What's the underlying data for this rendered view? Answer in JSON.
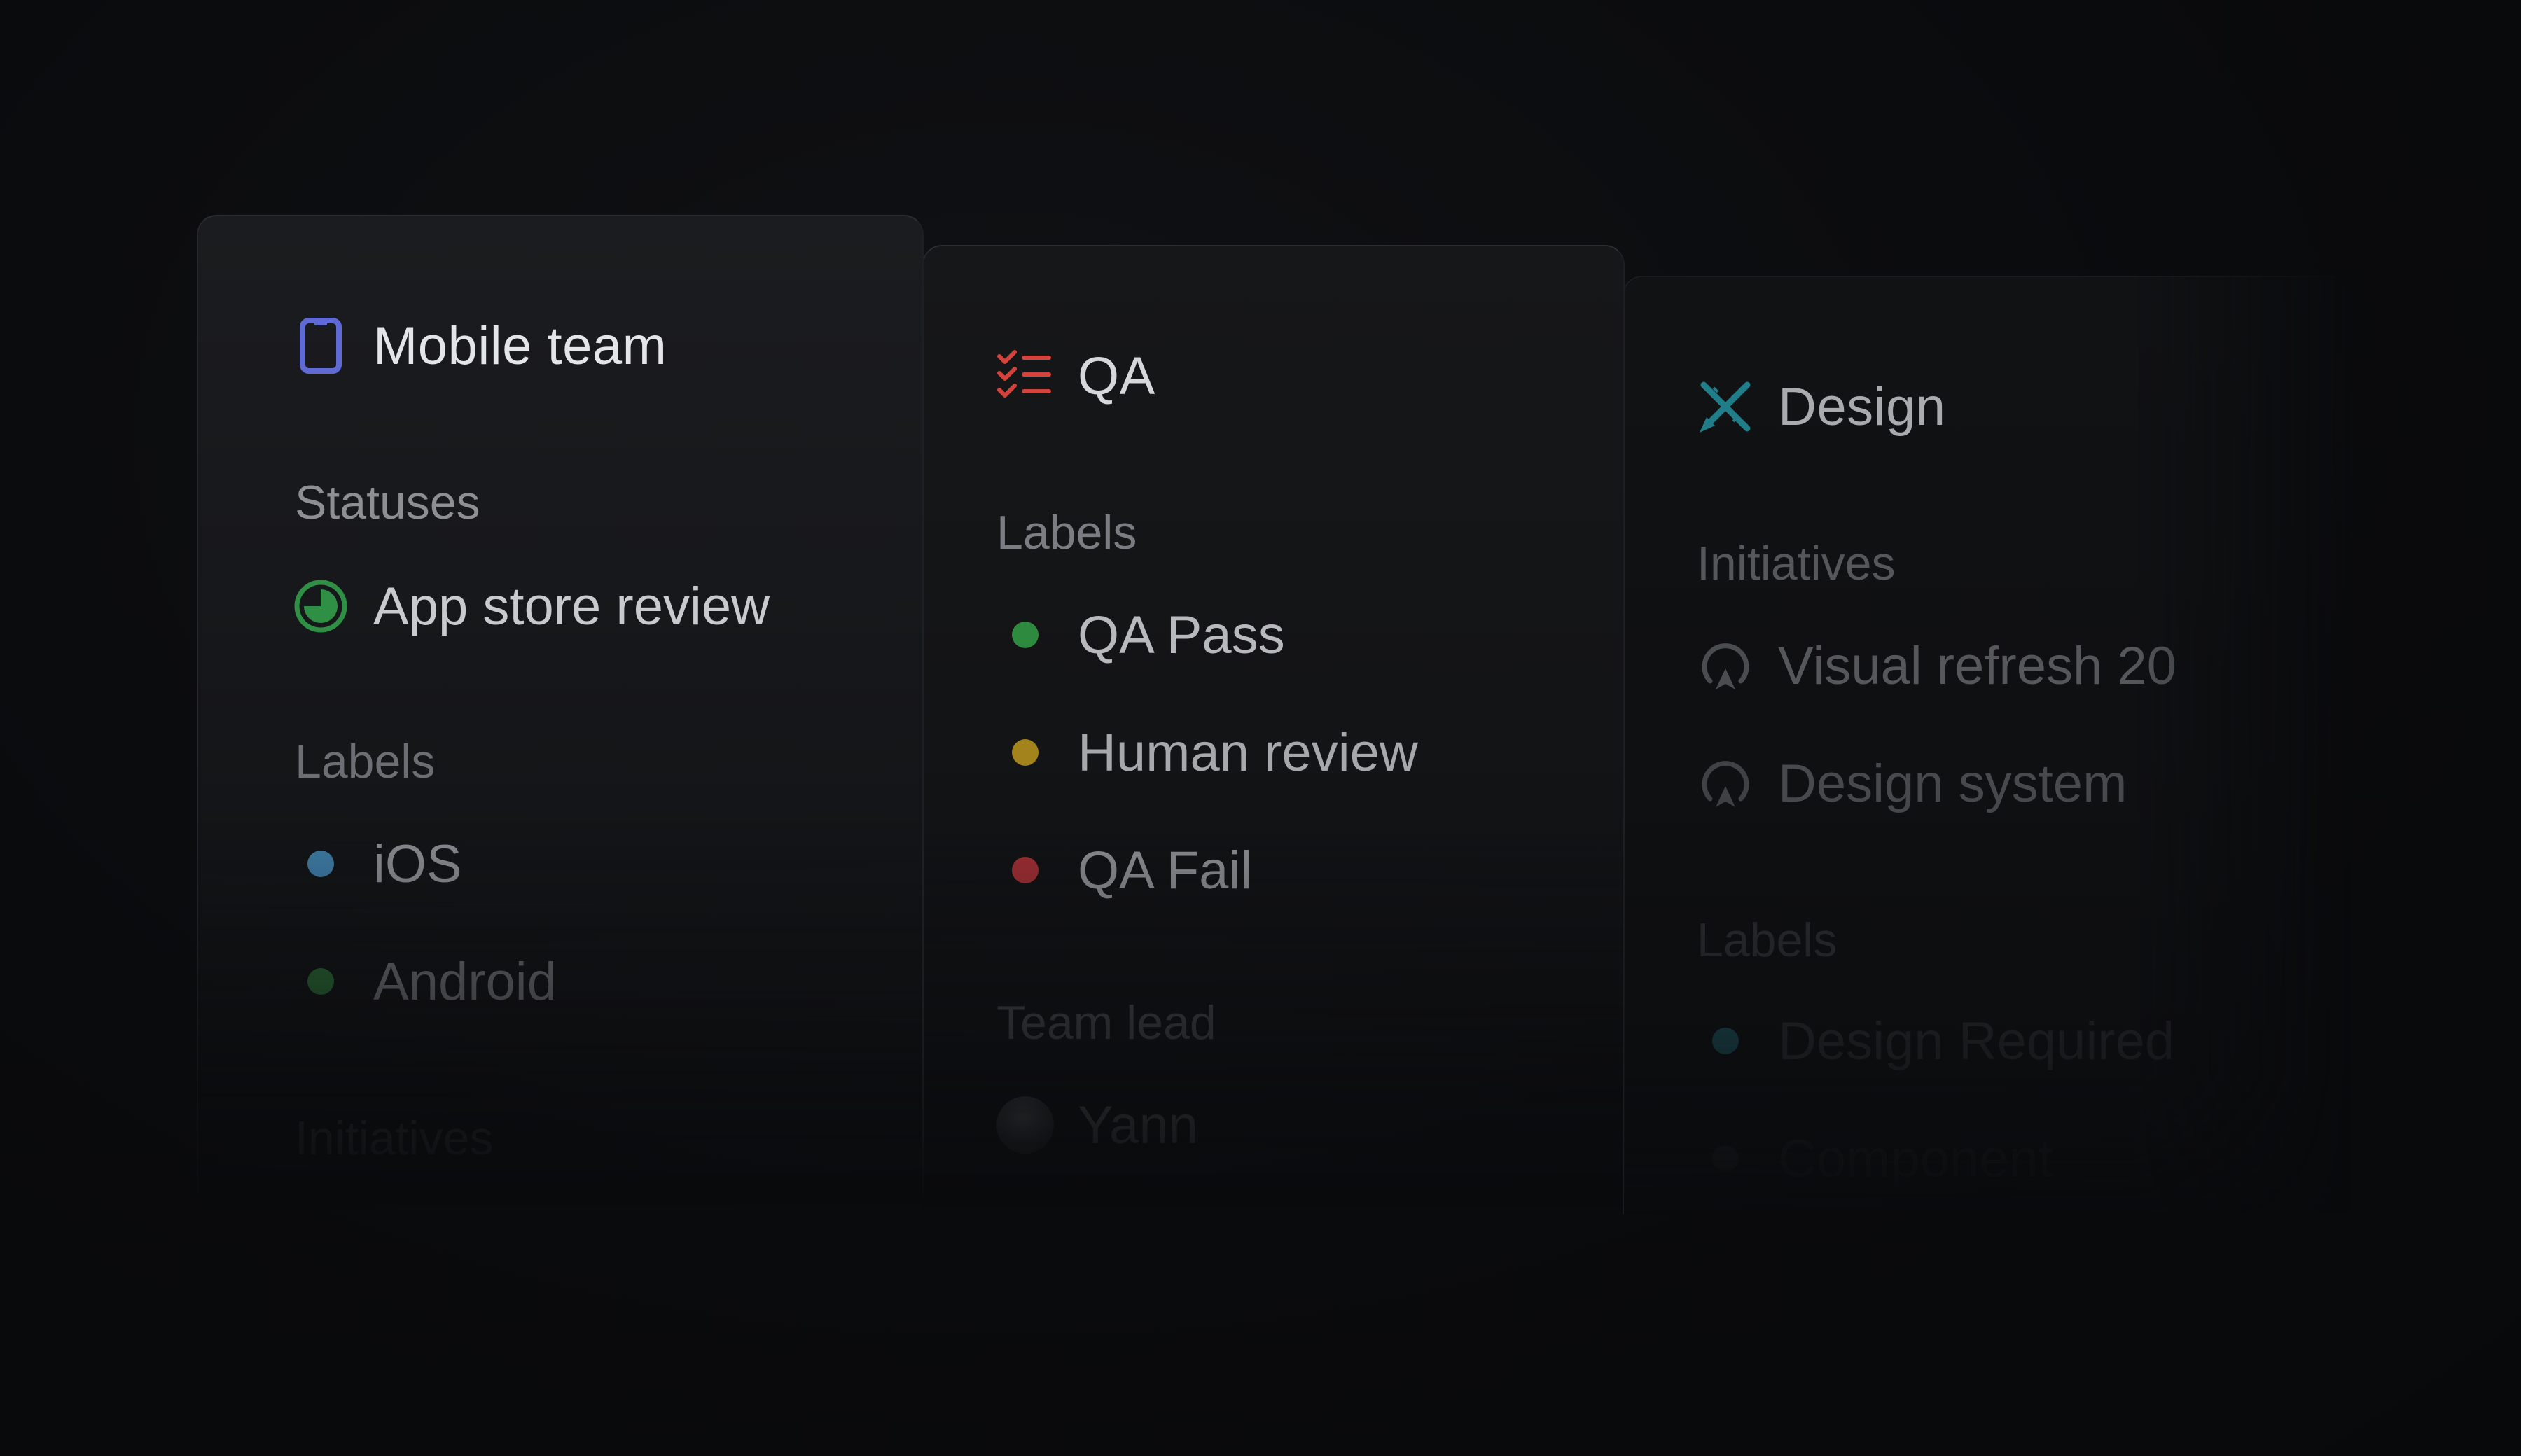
{
  "teams": {
    "mobile": {
      "name": "Mobile team",
      "icon": "phone-icon",
      "icon_color": "#5f6ad6",
      "statuses_title": "Statuses",
      "statuses": [
        {
          "label": "App store review",
          "icon": "status-progress-icon",
          "color": "#2f8f45"
        }
      ],
      "labels_title": "Labels",
      "labels": [
        {
          "label": "iOS",
          "color": "#3f7ea8"
        },
        {
          "label": "Android",
          "color": "#2a6a34"
        }
      ],
      "initiatives_title": "Initiatives"
    },
    "qa": {
      "name": "QA",
      "icon": "checklist-icon",
      "icon_color": "#d4423c",
      "labels_title": "Labels",
      "labels": [
        {
          "label": "QA Pass",
          "color": "#2e8a3e"
        },
        {
          "label": "Human review",
          "color": "#a3831c"
        },
        {
          "label": "QA Fail",
          "color": "#9c2e33"
        }
      ],
      "team_lead_title": "Team lead",
      "team_lead": {
        "name": "Yann",
        "icon": "avatar"
      }
    },
    "design": {
      "name": "Design",
      "icon": "design-tools-icon",
      "icon_color": "#1f7e89",
      "initiatives_title": "Initiatives",
      "initiatives": [
        {
          "label": "Visual refresh 20",
          "icon": "initiative-icon"
        },
        {
          "label": "Design system",
          "icon": "initiative-icon"
        }
      ],
      "labels_title": "Labels",
      "labels": [
        {
          "label": "Design Required",
          "color": "#1d5a63"
        },
        {
          "label": "Component",
          "color": "#2a2b2e"
        }
      ]
    }
  }
}
